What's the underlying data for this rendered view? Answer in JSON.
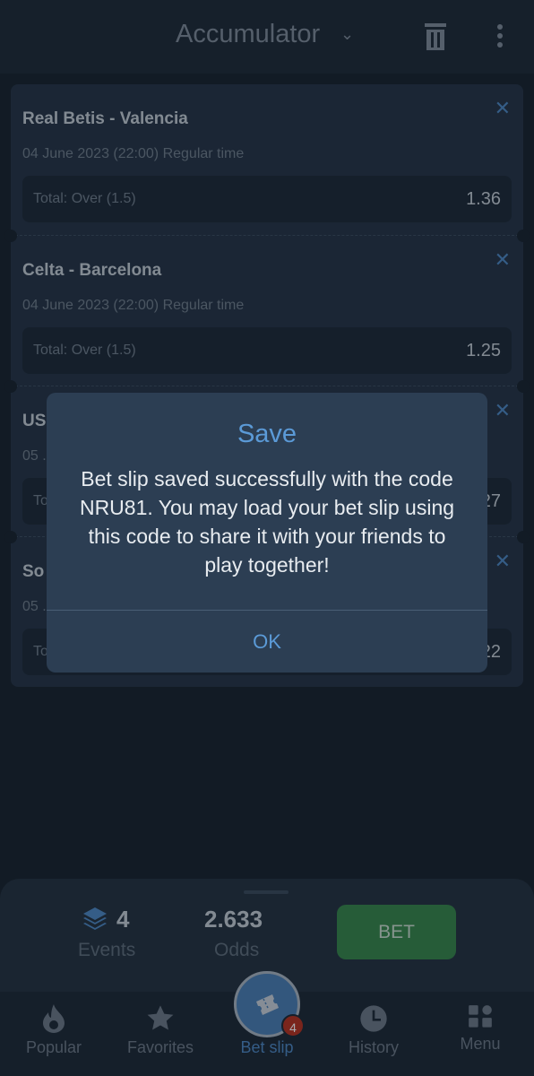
{
  "header": {
    "title": "Accumulator",
    "icons": [
      "chevron-down-icon",
      "trash-icon",
      "more-vertical-icon"
    ]
  },
  "events": [
    {
      "name": "Real Betis - Valencia",
      "date": "04 June 2023 (22:00) Regular time",
      "market": "Total: Over (1.5)",
      "odds": "1.36"
    },
    {
      "name": "Celta - Barcelona",
      "date": "04 June 2023 (22:00) Regular time",
      "market": "Total: Over (1.5)",
      "odds": "1.25"
    },
    {
      "name": "US",
      "date": "05 .",
      "market": "To",
      "odds": "27"
    },
    {
      "name": "So",
      "date": "05 .",
      "market": "To",
      "odds": "22"
    }
  ],
  "dialog": {
    "title": "Save",
    "message": "Bet slip saved successfully with the code NRU81. You may load your bet slip using this code to share it with your friends to play together!",
    "ok_label": "OK"
  },
  "summary": {
    "events_count": "4",
    "events_label": "Events",
    "odds_value": "2.633",
    "odds_label": "Odds",
    "bet_label": "BET"
  },
  "nav": {
    "items": [
      {
        "label": "Popular",
        "icon": "flame-icon"
      },
      {
        "label": "Favorites",
        "icon": "star-icon"
      },
      {
        "label": "Bet slip",
        "icon": "ticket-icon",
        "active": true
      },
      {
        "label": "History",
        "icon": "clock-icon"
      },
      {
        "label": "Menu",
        "icon": "grid-icon"
      }
    ],
    "badge": "4"
  },
  "colors": {
    "accent": "#5b9ad7",
    "bet": "#36864b",
    "badge": "#b7321f"
  }
}
